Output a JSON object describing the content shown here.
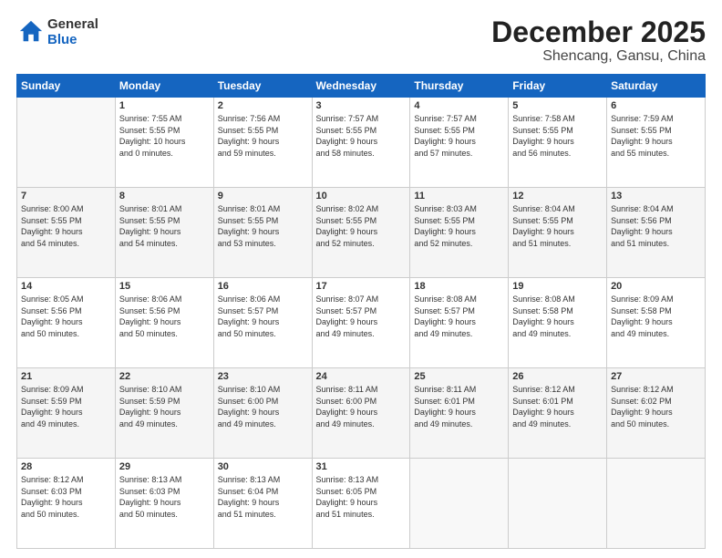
{
  "header": {
    "logo_line1": "General",
    "logo_line2": "Blue",
    "month": "December 2025",
    "location": "Shencang, Gansu, China"
  },
  "weekdays": [
    "Sunday",
    "Monday",
    "Tuesday",
    "Wednesday",
    "Thursday",
    "Friday",
    "Saturday"
  ],
  "weeks": [
    [
      {
        "num": "",
        "info": ""
      },
      {
        "num": "1",
        "info": "Sunrise: 7:55 AM\nSunset: 5:55 PM\nDaylight: 10 hours\nand 0 minutes."
      },
      {
        "num": "2",
        "info": "Sunrise: 7:56 AM\nSunset: 5:55 PM\nDaylight: 9 hours\nand 59 minutes."
      },
      {
        "num": "3",
        "info": "Sunrise: 7:57 AM\nSunset: 5:55 PM\nDaylight: 9 hours\nand 58 minutes."
      },
      {
        "num": "4",
        "info": "Sunrise: 7:57 AM\nSunset: 5:55 PM\nDaylight: 9 hours\nand 57 minutes."
      },
      {
        "num": "5",
        "info": "Sunrise: 7:58 AM\nSunset: 5:55 PM\nDaylight: 9 hours\nand 56 minutes."
      },
      {
        "num": "6",
        "info": "Sunrise: 7:59 AM\nSunset: 5:55 PM\nDaylight: 9 hours\nand 55 minutes."
      }
    ],
    [
      {
        "num": "7",
        "info": "Sunrise: 8:00 AM\nSunset: 5:55 PM\nDaylight: 9 hours\nand 54 minutes."
      },
      {
        "num": "8",
        "info": "Sunrise: 8:01 AM\nSunset: 5:55 PM\nDaylight: 9 hours\nand 54 minutes."
      },
      {
        "num": "9",
        "info": "Sunrise: 8:01 AM\nSunset: 5:55 PM\nDaylight: 9 hours\nand 53 minutes."
      },
      {
        "num": "10",
        "info": "Sunrise: 8:02 AM\nSunset: 5:55 PM\nDaylight: 9 hours\nand 52 minutes."
      },
      {
        "num": "11",
        "info": "Sunrise: 8:03 AM\nSunset: 5:55 PM\nDaylight: 9 hours\nand 52 minutes."
      },
      {
        "num": "12",
        "info": "Sunrise: 8:04 AM\nSunset: 5:55 PM\nDaylight: 9 hours\nand 51 minutes."
      },
      {
        "num": "13",
        "info": "Sunrise: 8:04 AM\nSunset: 5:56 PM\nDaylight: 9 hours\nand 51 minutes."
      }
    ],
    [
      {
        "num": "14",
        "info": "Sunrise: 8:05 AM\nSunset: 5:56 PM\nDaylight: 9 hours\nand 50 minutes."
      },
      {
        "num": "15",
        "info": "Sunrise: 8:06 AM\nSunset: 5:56 PM\nDaylight: 9 hours\nand 50 minutes."
      },
      {
        "num": "16",
        "info": "Sunrise: 8:06 AM\nSunset: 5:57 PM\nDaylight: 9 hours\nand 50 minutes."
      },
      {
        "num": "17",
        "info": "Sunrise: 8:07 AM\nSunset: 5:57 PM\nDaylight: 9 hours\nand 49 minutes."
      },
      {
        "num": "18",
        "info": "Sunrise: 8:08 AM\nSunset: 5:57 PM\nDaylight: 9 hours\nand 49 minutes."
      },
      {
        "num": "19",
        "info": "Sunrise: 8:08 AM\nSunset: 5:58 PM\nDaylight: 9 hours\nand 49 minutes."
      },
      {
        "num": "20",
        "info": "Sunrise: 8:09 AM\nSunset: 5:58 PM\nDaylight: 9 hours\nand 49 minutes."
      }
    ],
    [
      {
        "num": "21",
        "info": "Sunrise: 8:09 AM\nSunset: 5:59 PM\nDaylight: 9 hours\nand 49 minutes."
      },
      {
        "num": "22",
        "info": "Sunrise: 8:10 AM\nSunset: 5:59 PM\nDaylight: 9 hours\nand 49 minutes."
      },
      {
        "num": "23",
        "info": "Sunrise: 8:10 AM\nSunset: 6:00 PM\nDaylight: 9 hours\nand 49 minutes."
      },
      {
        "num": "24",
        "info": "Sunrise: 8:11 AM\nSunset: 6:00 PM\nDaylight: 9 hours\nand 49 minutes."
      },
      {
        "num": "25",
        "info": "Sunrise: 8:11 AM\nSunset: 6:01 PM\nDaylight: 9 hours\nand 49 minutes."
      },
      {
        "num": "26",
        "info": "Sunrise: 8:12 AM\nSunset: 6:01 PM\nDaylight: 9 hours\nand 49 minutes."
      },
      {
        "num": "27",
        "info": "Sunrise: 8:12 AM\nSunset: 6:02 PM\nDaylight: 9 hours\nand 50 minutes."
      }
    ],
    [
      {
        "num": "28",
        "info": "Sunrise: 8:12 AM\nSunset: 6:03 PM\nDaylight: 9 hours\nand 50 minutes."
      },
      {
        "num": "29",
        "info": "Sunrise: 8:13 AM\nSunset: 6:03 PM\nDaylight: 9 hours\nand 50 minutes."
      },
      {
        "num": "30",
        "info": "Sunrise: 8:13 AM\nSunset: 6:04 PM\nDaylight: 9 hours\nand 51 minutes."
      },
      {
        "num": "31",
        "info": "Sunrise: 8:13 AM\nSunset: 6:05 PM\nDaylight: 9 hours\nand 51 minutes."
      },
      {
        "num": "",
        "info": ""
      },
      {
        "num": "",
        "info": ""
      },
      {
        "num": "",
        "info": ""
      }
    ]
  ]
}
